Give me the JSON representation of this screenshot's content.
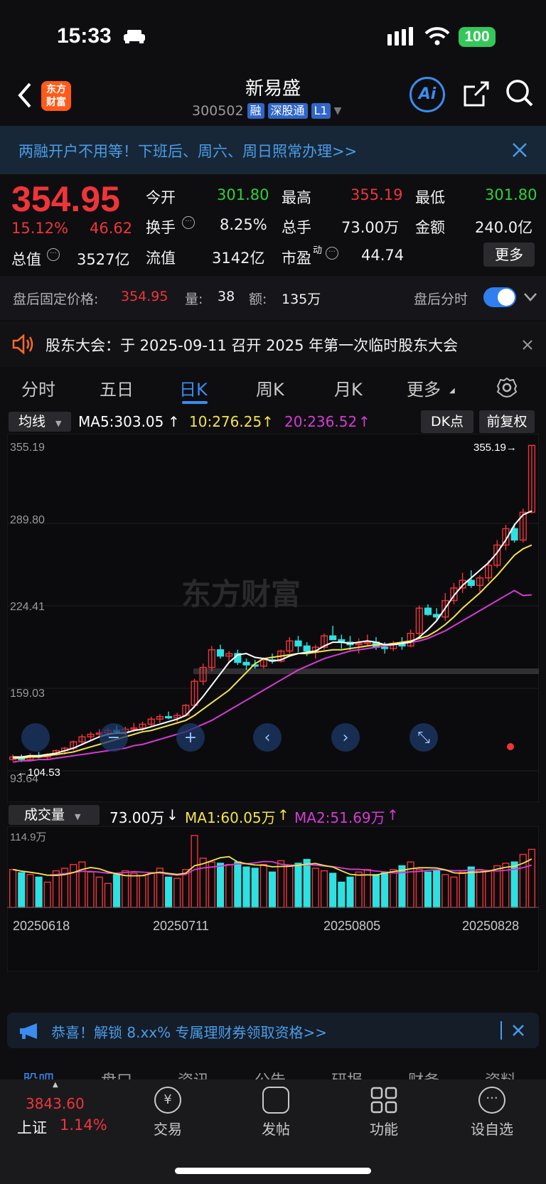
{
  "status": {
    "time": "15:33",
    "battery": "100"
  },
  "header": {
    "logo": "东方财富",
    "name": "新易盛",
    "code": "300502",
    "tags": [
      "融",
      "深股通",
      "L1"
    ],
    "ai": "Ai"
  },
  "banner": {
    "text": "两融开户不用等！下班后、周六、周日照常办理>>"
  },
  "quote": {
    "price": "354.95",
    "pct": "15.12%",
    "chg": "46.62",
    "open_label": "今开",
    "open": "301.80",
    "high_label": "最高",
    "high": "355.19",
    "low_label": "最低",
    "low": "301.80",
    "turnover_label": "换手",
    "turnover": "8.25%",
    "volume_label": "总手",
    "volume": "73.00万",
    "amount_label": "金额",
    "amount": "240.0亿",
    "mktcap_label": "总值",
    "mktcap": "3527亿",
    "float_label": "流值",
    "float": "3142亿",
    "pe_label": "市盈",
    "pe_sup": "动",
    "pe": "44.74",
    "more": "更多"
  },
  "afterhours": {
    "label": "盘后固定价格:",
    "price": "354.95",
    "qty_label": "量:",
    "qty": "38",
    "amt_label": "额:",
    "amt": "135万",
    "switch_label": "盘后分时",
    "switch_on": true
  },
  "notice": {
    "text": "股东大会：于 2025-09-11 召开 2025 年第一次临时股东大会"
  },
  "tabs": [
    "分时",
    "五日",
    "日K",
    "周K",
    "月K",
    "更多"
  ],
  "active_tab": "日K",
  "ma": {
    "selector": "均线",
    "ma5": "MA5:303.05",
    "ma10": "10:276.25",
    "ma20": "20:236.52",
    "dk": "DK点",
    "adjust": "前复权"
  },
  "vol_indicator": {
    "selector": "成交量",
    "value": "73.00万",
    "ma1": "MA1:60.05万",
    "ma2": "MA2:51.69万"
  },
  "promo": {
    "text": "恭喜！解锁 8.xx% 专属理财券领取资格>>"
  },
  "subtabs": [
    "股吧",
    "盘口",
    "资讯",
    "公告",
    "研报",
    "财务",
    "资料"
  ],
  "bottom": {
    "index_value": "3843.60",
    "index_name": "上证",
    "index_pct": "1.14%",
    "items": [
      "交易",
      "发帖",
      "功能",
      "设自选"
    ]
  },
  "colors": {
    "up": "#f0343a",
    "down": "#2fe0e0",
    "ma5": "#ffffff",
    "ma10": "#f2e44a",
    "ma20": "#d63ad6",
    "accent": "#3b8cf0"
  },
  "chart_data": {
    "type": "candlestick",
    "y_labels": [
      "355.19",
      "289.80",
      "224.41",
      "159.03",
      "93.64"
    ],
    "ylim": [
      93.64,
      355.19
    ],
    "max_label": "355.19",
    "min_label": "104.53",
    "x_labels": [
      "20250618",
      "20250711",
      "20250805",
      "20250828"
    ],
    "vol_max_label": "114.9万",
    "watermark": "东方财富",
    "candles": [
      [
        106,
        110,
        105,
        108
      ],
      [
        108,
        110,
        104,
        106
      ],
      [
        106,
        111,
        105,
        109
      ],
      [
        109,
        112,
        107,
        108
      ],
      [
        108,
        111,
        106,
        110
      ],
      [
        110,
        114,
        109,
        113
      ],
      [
        113,
        116,
        110,
        115
      ],
      [
        115,
        121,
        113,
        120
      ],
      [
        120,
        126,
        118,
        124
      ],
      [
        124,
        128,
        121,
        126
      ],
      [
        126,
        130,
        123,
        127
      ],
      [
        127,
        131,
        124,
        129
      ],
      [
        129,
        133,
        126,
        128
      ],
      [
        128,
        132,
        125,
        130
      ],
      [
        130,
        135,
        128,
        131
      ],
      [
        131,
        136,
        129,
        134
      ],
      [
        134,
        140,
        132,
        138
      ],
      [
        138,
        142,
        135,
        140
      ],
      [
        140,
        144,
        138,
        139
      ],
      [
        139,
        143,
        136,
        141
      ],
      [
        141,
        150,
        140,
        149
      ],
      [
        149,
        170,
        147,
        168
      ],
      [
        168,
        182,
        165,
        179
      ],
      [
        179,
        196,
        176,
        193
      ],
      [
        193,
        197,
        186,
        188
      ],
      [
        188,
        192,
        183,
        190
      ],
      [
        190,
        193,
        181,
        183
      ],
      [
        183,
        186,
        177,
        181
      ],
      [
        181,
        185,
        178,
        180
      ],
      [
        180,
        187,
        178,
        185
      ],
      [
        185,
        190,
        182,
        184
      ],
      [
        184,
        193,
        183,
        192
      ],
      [
        192,
        203,
        190,
        200
      ],
      [
        200,
        204,
        191,
        196
      ],
      [
        196,
        199,
        188,
        192
      ],
      [
        192,
        197,
        186,
        195
      ],
      [
        195,
        206,
        193,
        204
      ],
      [
        204,
        212,
        201,
        201
      ],
      [
        201,
        205,
        194,
        199
      ],
      [
        199,
        204,
        193,
        197
      ],
      [
        197,
        202,
        190,
        198
      ],
      [
        198,
        205,
        196,
        199
      ],
      [
        199,
        203,
        193,
        195
      ],
      [
        195,
        199,
        190,
        194
      ],
      [
        194,
        200,
        192,
        198
      ],
      [
        198,
        203,
        193,
        196
      ],
      [
        196,
        209,
        195,
        206
      ],
      [
        206,
        228,
        204,
        226
      ],
      [
        226,
        229,
        220,
        221
      ],
      [
        221,
        226,
        216,
        219
      ],
      [
        219,
        238,
        216,
        232
      ],
      [
        232,
        246,
        229,
        242
      ],
      [
        242,
        254,
        238,
        248
      ],
      [
        248,
        256,
        242,
        244
      ],
      [
        244,
        252,
        239,
        250
      ],
      [
        250,
        264,
        247,
        260
      ],
      [
        260,
        280,
        258,
        276
      ],
      [
        276,
        292,
        272,
        289
      ],
      [
        289,
        293,
        278,
        280
      ],
      [
        280,
        305,
        278,
        302
      ],
      [
        302,
        355,
        301,
        355
      ]
    ],
    "volumes": [
      60,
      55,
      52,
      48,
      40,
      58,
      62,
      68,
      72,
      56,
      48,
      38,
      52,
      58,
      54,
      50,
      55,
      62,
      48,
      46,
      60,
      114,
      78,
      72,
      70,
      68,
      72,
      64,
      62,
      68,
      56,
      74,
      66,
      70,
      76,
      62,
      58,
      54,
      40,
      48,
      56,
      60,
      52,
      56,
      60,
      66,
      72,
      60,
      56,
      58,
      52,
      48,
      56,
      64,
      60,
      58,
      66,
      70,
      72,
      84,
      92
    ],
    "ma5": [
      108,
      108,
      109,
      109,
      110,
      111,
      113,
      115,
      118,
      121,
      124,
      126,
      127,
      127,
      129,
      130,
      132,
      134,
      136,
      138,
      141,
      148,
      156,
      165,
      174,
      183,
      189,
      190,
      187,
      186,
      184,
      185,
      188,
      190,
      191,
      192,
      196,
      199,
      199,
      198,
      199,
      200,
      199,
      197,
      197,
      198,
      199,
      203,
      209,
      216,
      226,
      236,
      244,
      250,
      256,
      262,
      270,
      280,
      292,
      300,
      303
    ],
    "ma10": [
      107,
      107,
      108,
      108,
      109,
      110,
      111,
      112,
      114,
      116,
      118,
      120,
      122,
      124,
      126,
      128,
      129,
      131,
      133,
      135,
      137,
      141,
      146,
      151,
      156,
      161,
      168,
      175,
      182,
      186,
      187,
      188,
      189,
      190,
      190,
      191,
      192,
      193,
      193,
      194,
      195,
      196,
      197,
      197,
      198,
      199,
      200,
      202,
      204,
      208,
      213,
      219,
      226,
      232,
      238,
      245,
      252,
      260,
      268,
      273,
      276
    ],
    "ma20": [
      104,
      105,
      105,
      106,
      106,
      107,
      108,
      109,
      110,
      111,
      112,
      113,
      114,
      115,
      117,
      118,
      120,
      122,
      124,
      126,
      128,
      131,
      134,
      137,
      141,
      145,
      149,
      153,
      157,
      161,
      165,
      169,
      173,
      177,
      180,
      183,
      186,
      188,
      190,
      192,
      193,
      194,
      195,
      196,
      197,
      198,
      199,
      200,
      202,
      205,
      208,
      212,
      216,
      220,
      224,
      228,
      232,
      236,
      240,
      236,
      236.52
    ]
  }
}
